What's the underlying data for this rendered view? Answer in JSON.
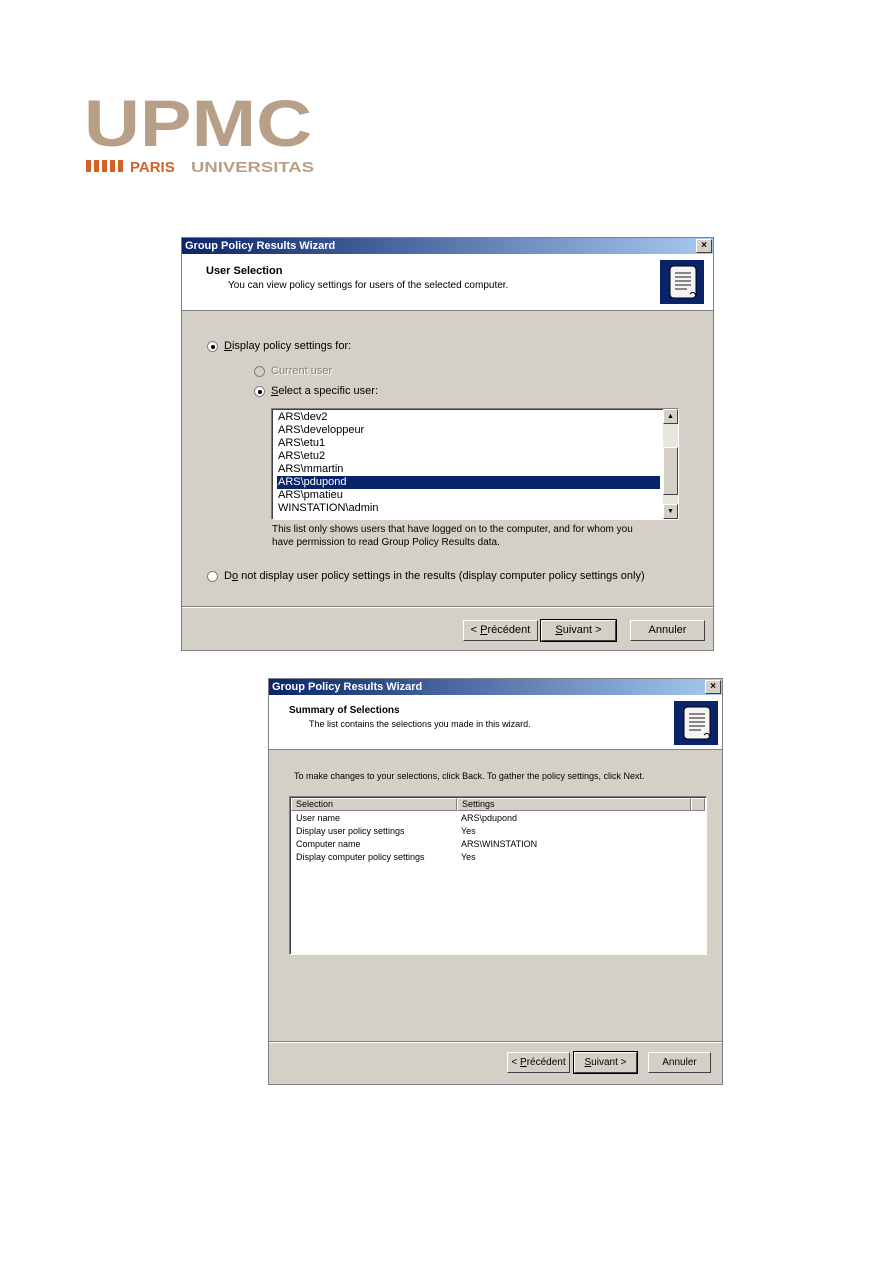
{
  "logo": {
    "main": "UPMC",
    "paris": "PARIS",
    "universitas": "UNIVERSITAS"
  },
  "colors": {
    "logo_tan": "#b8a088",
    "logo_orange": "#d2622a",
    "title_blue": "#0a246a",
    "selection_blue": "#0a246a",
    "dialog_face": "#d4d0c8"
  },
  "dialog1": {
    "title": "Group Policy Results Wizard",
    "close": "×",
    "header_title": "User Selection",
    "header_subtitle": "You can view policy settings for users of the selected computer.",
    "icon": "scroll-document-icon",
    "radio_display": {
      "prefix": "D",
      "rest": "isplay policy settings for:",
      "checked": true
    },
    "radio_current": {
      "label": "Current user",
      "checked": false,
      "disabled": true
    },
    "radio_specific": {
      "prefix": "S",
      "rest": "elect a specific user:",
      "checked": true
    },
    "users": [
      "ARS\\dev2",
      "ARS\\developpeur",
      "ARS\\etu1",
      "ARS\\etu2",
      "ARS\\mmartin",
      "ARS\\pdupond",
      "ARS\\pmatieu",
      "WINSTATION\\admin"
    ],
    "selected_user": "ARS\\pdupond",
    "note_line1": "This list only shows users that have logged on to the computer, and for whom you",
    "note_line2": "have permission to read Group Policy Results data.",
    "radio_none": {
      "pre": "D",
      "under": "o",
      "rest": " not display user policy settings in the results (display computer policy settings only)",
      "checked": false
    },
    "buttons": {
      "back": {
        "pre": "< ",
        "under": "P",
        "rest": "récédent"
      },
      "next": {
        "under": "S",
        "rest": "uivant >"
      },
      "cancel": "Annuler"
    }
  },
  "dialog2": {
    "title": "Group Policy Results Wizard",
    "close": "×",
    "header_title": "Summary of Selections",
    "header_subtitle": "The list contains the selections you made in this wizard.",
    "icon": "scroll-document-icon",
    "intro": "To make changes to your selections, click Back. To gather the policy settings, click Next.",
    "columns": [
      "Selection",
      "Settings"
    ],
    "rows": [
      [
        "User name",
        "ARS\\pdupond"
      ],
      [
        "Display user policy settings",
        "Yes"
      ],
      [
        "Computer name",
        "ARS\\WINSTATION"
      ],
      [
        "Display computer policy settings",
        "Yes"
      ]
    ],
    "buttons": {
      "back": {
        "pre": "< ",
        "under": "P",
        "rest": "récédent"
      },
      "next": {
        "under": "S",
        "rest": "uivant >"
      },
      "cancel": "Annuler"
    }
  }
}
